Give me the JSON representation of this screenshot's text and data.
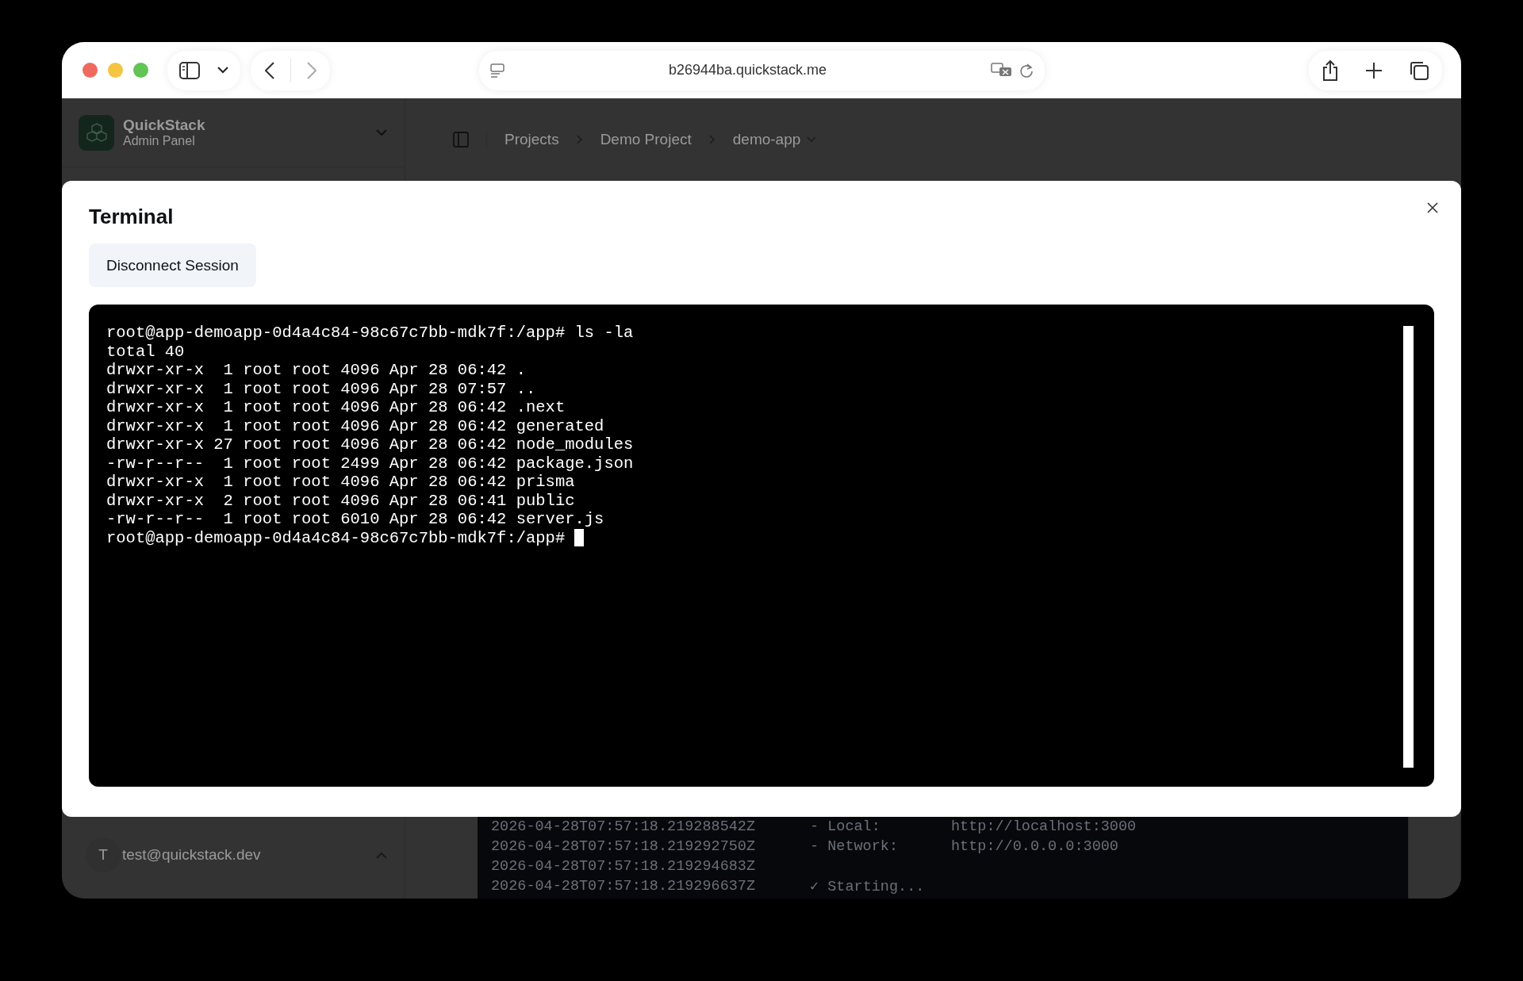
{
  "browser": {
    "url": "b26944ba.quickstack.me"
  },
  "sidebar": {
    "app_name": "QuickStack",
    "app_subtitle": "Admin Panel",
    "user_initial": "T",
    "user_email": "test@quickstack.dev"
  },
  "breadcrumbs": [
    {
      "label": "Projects",
      "dropdown": false
    },
    {
      "label": "Demo Project",
      "dropdown": false
    },
    {
      "label": "demo-app",
      "dropdown": true
    }
  ],
  "modal": {
    "title": "Terminal",
    "button": "Disconnect Session",
    "terminal_lines": [
      "root@app-demoapp-0d4a4c84-98c67c7bb-mdk7f:/app# ls -la",
      "total 40",
      "drwxr-xr-x  1 root root 4096 Apr 28 06:42 .",
      "drwxr-xr-x  1 root root 4096 Apr 28 07:57 ..",
      "drwxr-xr-x  1 root root 4096 Apr 28 06:42 .next",
      "drwxr-xr-x  1 root root 4096 Apr 28 06:42 generated",
      "drwxr-xr-x 27 root root 4096 Apr 28 06:42 node_modules",
      "-rw-r--r--  1 root root 2499 Apr 28 06:42 package.json",
      "drwxr-xr-x  1 root root 4096 Apr 28 06:42 prisma",
      "drwxr-xr-x  2 root root 4096 Apr 28 06:41 public",
      "-rw-r--r--  1 root root 6010 Apr 28 06:42 server.js",
      "root@app-demoapp-0d4a4c84-98c67c7bb-mdk7f:/app#"
    ]
  },
  "logs": [
    {
      "timestamp": "2026-04-28T07:57:18.219288542Z",
      "message": "- Local:",
      "value": "http://localhost:3000"
    },
    {
      "timestamp": "2026-04-28T07:57:18.219292750Z",
      "message": "- Network:",
      "value": "http://0.0.0.0:3000"
    },
    {
      "timestamp": "2026-04-28T07:57:18.219294683Z"
    },
    {
      "timestamp": "2026-04-28T07:57:18.219296637Z",
      "message": "✓ Starting..."
    }
  ]
}
